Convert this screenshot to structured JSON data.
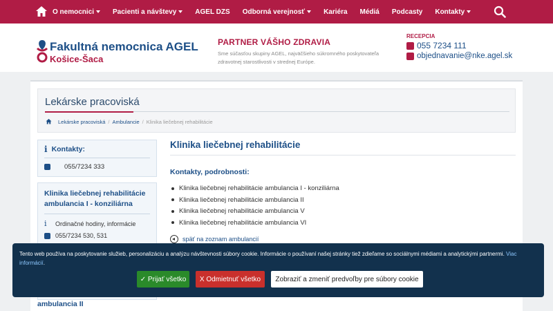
{
  "nav": {
    "items": [
      {
        "label": "O nemocnici",
        "dropdown": true
      },
      {
        "label": "Pacienti a návštevy",
        "dropdown": true
      },
      {
        "label": "AGEL DZS",
        "dropdown": false
      },
      {
        "label": "Odborná verejnosť",
        "dropdown": true
      },
      {
        "label": "Kariéra",
        "dropdown": false
      },
      {
        "label": "Médiá",
        "dropdown": false
      },
      {
        "label": "Podcasty",
        "dropdown": false
      },
      {
        "label": "Kontakty",
        "dropdown": true
      }
    ],
    "home_icon": "home-icon",
    "search_icon": "search-icon"
  },
  "header": {
    "logo_name": "Fakultná nemocnica AGEL",
    "logo_city": "Košice-Šaca",
    "partner_title": "PARTNER VÁŠHO ZDRAVIA",
    "partner_desc": "Sme súčasťou skupiny AGEL, najväčšieho súkromného poskytovateľa zdravotnej starostlivosti v strednej Európe.",
    "reception_label": "RECEPCIA",
    "reception_phone": "055 7234 111",
    "reception_email": "objednavanie@nke.agel.sk"
  },
  "page": {
    "title": "Lekárske pracoviská",
    "breadcrumb": [
      "Lekárske pracoviská",
      "Ambulancie",
      "Klinika liečebnej rehabilitácie"
    ]
  },
  "sidebar": {
    "contacts_title": "Kontakty:",
    "contacts_phone": "055/7234 333",
    "clinic_title": "Klinika liečebnej rehabilitácie ambulancia I - konziliárna",
    "clinic_hours": "Ordinačné hodiny, informácie",
    "clinic_phone": "055/7234 530, 531",
    "next_title_fragment": "ambulancia II"
  },
  "main": {
    "heading": "Klinika liečebnej rehabilitácie",
    "subheading": "Kontakty, podrobnosti:",
    "items": [
      "Klinika liečebnej rehabilitácie ambulancia I - konziliárna",
      "Klinika liečebnej rehabilitácie ambulancia II",
      "Klinika liečebnej rehabilitácie ambulancia V",
      "Klinika liečebnej rehabilitácie ambulancia VI"
    ],
    "back_link": "späť na zoznam ambulancií"
  },
  "cookie": {
    "text": "Tento web používa na poskytovanie služieb, personalizáciu a analýzu návštevnosti súbory cookie. Informácie o používaní našej stránky tiež zdieľame so sociálnymi médiami a analytickými partnermi.",
    "more_link": "Viac informácií",
    "accept_label": "✓ Prijať všetko",
    "reject_label": "X Odmietnuť všetko",
    "prefs_label": "Zobraziť a zmeniť predvoľby pre súbory cookie"
  },
  "colors": {
    "brand_red": "#b01c45",
    "brand_blue": "#1d4f87",
    "cookie_bg": "#12314d",
    "accept": "#2a8a2a",
    "reject": "#c9302c"
  }
}
